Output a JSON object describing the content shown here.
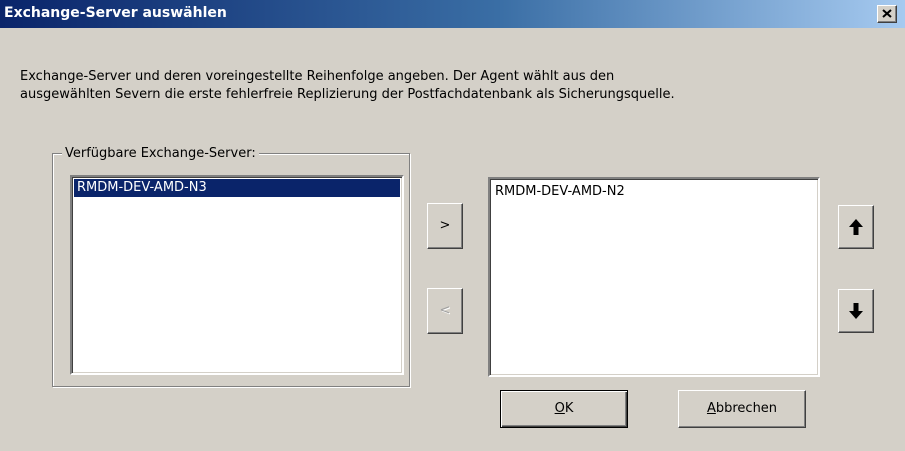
{
  "window": {
    "title": "Exchange-Server auswählen",
    "close_icon": "close-icon"
  },
  "description": {
    "line1": "Exchange-Server und deren voreingestellte Reihenfolge angeben. Der Agent wählt aus den",
    "line2": "ausgewählten Severn die erste fehlerfreie Replizierung der Postfachdatenbank als Sicherungsquelle."
  },
  "available": {
    "group_label": "Verfügbare Exchange-Server:",
    "items": [
      "RMDM-DEV-AMD-N3"
    ],
    "selected_index": 0
  },
  "selected_servers": {
    "items": [
      "RMDM-DEV-AMD-N2"
    ]
  },
  "buttons": {
    "add": ">",
    "remove": "<",
    "move_up_icon": "arrow-up-icon",
    "move_down_icon": "arrow-down-icon",
    "ok": {
      "mnemonic": "O",
      "rest": "K"
    },
    "cancel": {
      "mnemonic": "A",
      "rest": "bbrechen"
    }
  },
  "colors": {
    "titlebar_start": "#0a246a",
    "selection": "#0a246a",
    "face": "#d4d0c8"
  }
}
